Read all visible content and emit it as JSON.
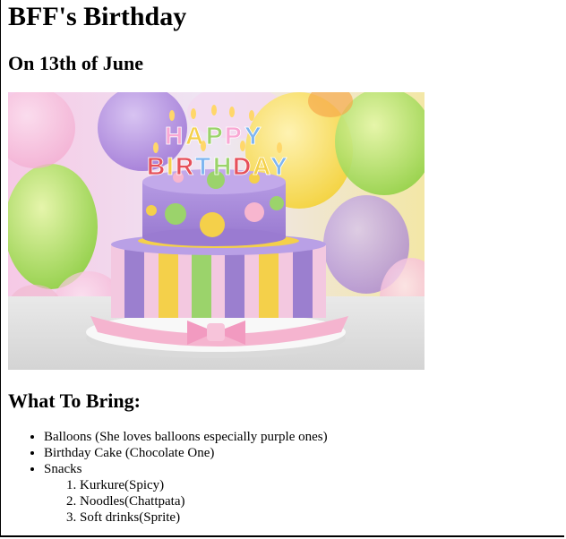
{
  "page": {
    "title": "BFF's Birthday",
    "subtitle": "On 13th of June",
    "image": {
      "alt_icon": "birthday-cake-image",
      "banner_text": "HAPPY BIRTHDAY",
      "colors": {
        "purple": "#9b7fcf",
        "yellow": "#f4d04a",
        "green": "#9bd36b",
        "pink": "#f7b6cf",
        "board": "#f2f2f2"
      }
    },
    "bring_heading": "What To Bring:",
    "items": [
      "Balloons (She loves balloons especially purple ones)",
      "Birthday Cake (Chocolate One)",
      "Snacks"
    ],
    "snacks": [
      "Kurkure(Spicy)",
      "Noodles(Chattpata)",
      "Soft drinks(Sprite)"
    ]
  }
}
